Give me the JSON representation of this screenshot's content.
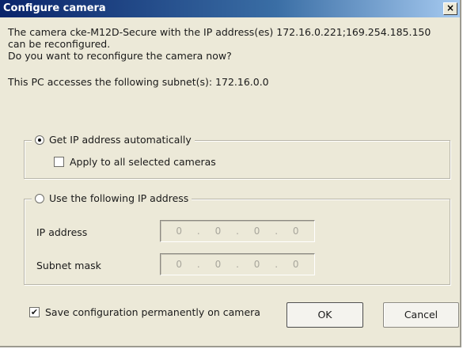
{
  "window": {
    "title": "Configure camera",
    "close_glyph": "×"
  },
  "message": {
    "line1": "The camera cke-M12D-Secure with the IP address(es) 172.16.0.221;169.254.185.150",
    "line2": "can be reconfigured.",
    "line3": "Do you want to reconfigure the camera now?",
    "subnet": "This PC accesses the following subnet(s): 172.16.0.0"
  },
  "auto_group": {
    "label": "Get IP address automatically",
    "selected": true,
    "apply_all_label": "Apply to all selected cameras",
    "apply_all_checked": false
  },
  "manual_group": {
    "label": "Use the following IP address",
    "selected": false,
    "ip_label": "IP address",
    "ip_octets": [
      "0",
      ".",
      "0",
      ".",
      "0",
      ".",
      "0"
    ],
    "mask_label": "Subnet mask",
    "mask_octets": [
      "0",
      ".",
      "0",
      ".",
      "0",
      ".",
      "0"
    ]
  },
  "footer": {
    "save_label": "Save configuration permanently on camera",
    "save_checked": true,
    "check_glyph": "✔",
    "ok_label": "OK",
    "cancel_label": "Cancel"
  }
}
